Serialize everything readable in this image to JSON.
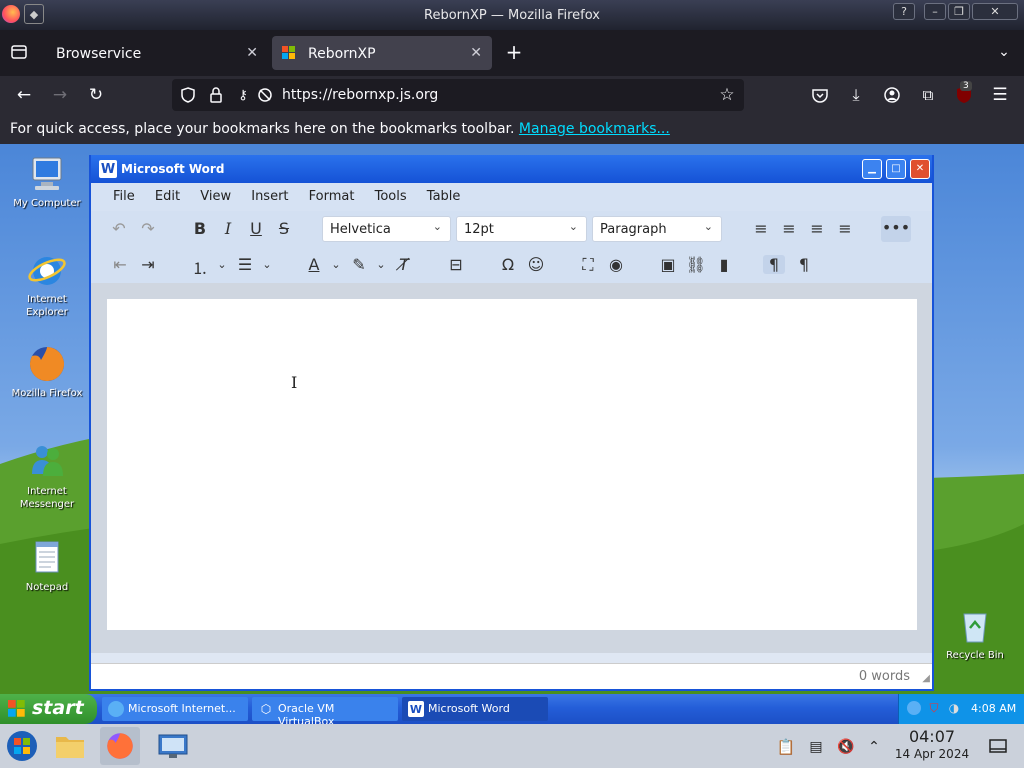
{
  "browser": {
    "window_title": "RebornXP — Mozilla Firefox",
    "tabs": [
      {
        "label": "Browservice",
        "active": false
      },
      {
        "label": "RebornXP",
        "active": true
      }
    ],
    "url": "https://rebornxp.js.org",
    "extension_badge": "3",
    "bookmarks_message": "For quick access, place your bookmarks here on the bookmarks toolbar.",
    "manage_bookmarks": "Manage bookmarks..."
  },
  "desktop": {
    "icons": [
      {
        "label": "My Computer"
      },
      {
        "label": "Internet Explorer"
      },
      {
        "label": "Mozilla Firefox"
      },
      {
        "label": "Internet Messenger"
      },
      {
        "label": "Notepad"
      },
      {
        "label": "Recycle Bin"
      }
    ]
  },
  "word": {
    "title": "Microsoft Word",
    "menu": [
      "File",
      "Edit",
      "View",
      "Insert",
      "Format",
      "Tools",
      "Table"
    ],
    "font_family": "Helvetica",
    "font_size": "12pt",
    "block_format": "Paragraph",
    "word_count": "0 words"
  },
  "xp_taskbar": {
    "start_label": "start",
    "items": [
      {
        "label": "Microsoft Internet..."
      },
      {
        "label": "Oracle VM VirtualBox"
      },
      {
        "label": "Microsoft Word"
      }
    ],
    "clock": "4:08 AM"
  },
  "host_taskbar": {
    "time": "04:07",
    "date": "14 Apr 2024"
  },
  "colors": {
    "xp_blue": "#245ed8",
    "xp_green": "#3c9a35",
    "firefox_dark": "#1c1b22",
    "link": "#00ddff"
  }
}
